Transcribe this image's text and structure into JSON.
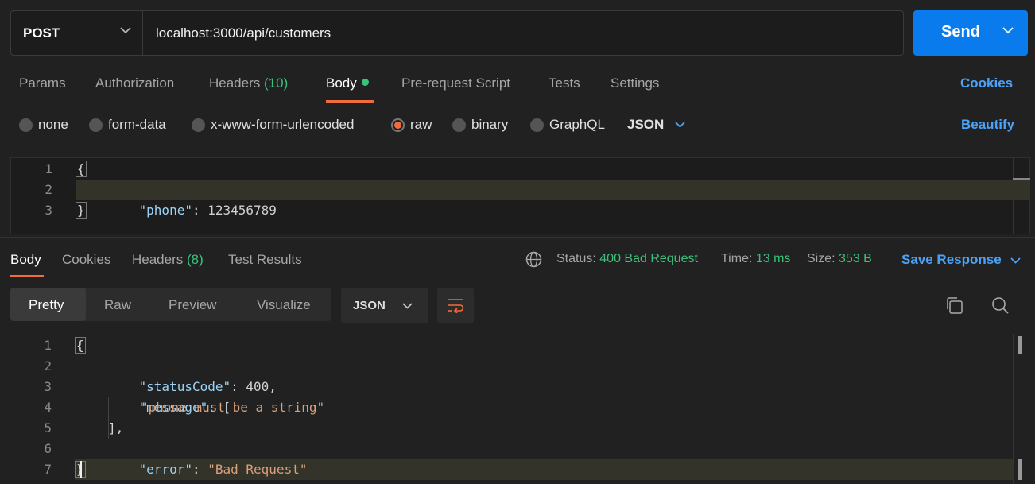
{
  "request": {
    "method": "POST",
    "url": "localhost:3000/api/customers",
    "send_label": "Send"
  },
  "request_tabs": {
    "params": "Params",
    "authorization": "Authorization",
    "headers": "Headers",
    "headers_count": "(10)",
    "body": "Body",
    "prerequest": "Pre-request Script",
    "tests": "Tests",
    "settings": "Settings",
    "cookies": "Cookies"
  },
  "body_types": {
    "none": "none",
    "form_data": "form-data",
    "urlencoded": "x-www-form-urlencoded",
    "raw": "raw",
    "binary": "binary",
    "graphql": "GraphQL",
    "format": "JSON",
    "beautify": "Beautify",
    "selected": "raw"
  },
  "request_body": {
    "line_numbers": [
      "1",
      "2",
      "3"
    ],
    "open_brace": "{",
    "key": "\"phone\"",
    "colon": ": ",
    "value": "123456789",
    "close_brace": "}"
  },
  "response_tabs": {
    "body": "Body",
    "cookies": "Cookies",
    "headers": "Headers",
    "headers_count": "(8)",
    "test_results": "Test Results"
  },
  "response_meta": {
    "status_label": "Status:",
    "status_value": "400 Bad Request",
    "time_label": "Time:",
    "time_value": "13 ms",
    "size_label": "Size:",
    "size_value": "353 B",
    "save_response": "Save Response"
  },
  "view_modes": {
    "pretty": "Pretty",
    "raw": "Raw",
    "preview": "Preview",
    "visualize": "Visualize",
    "format": "JSON",
    "selected": "Pretty"
  },
  "response_body": {
    "line_numbers": [
      "1",
      "2",
      "3",
      "4",
      "5",
      "6",
      "7"
    ],
    "open_brace": "{",
    "k_status": "\"statusCode\"",
    "v_status": "400",
    "k_message": "\"message\"",
    "open_bracket": "[",
    "v_message_item": "\"phone must be a string\"",
    "close_bracket": "],",
    "k_error": "\"error\"",
    "v_error": "\"Bad Request\"",
    "close_brace": "}",
    "colon": ": ",
    "comma": ","
  },
  "colors": {
    "accent": "#f26b3a",
    "send": "#097bed",
    "success": "#3ac27c",
    "link": "#4aa3f7"
  },
  "icons": {
    "globe": "globe-icon",
    "copy": "copy-icon",
    "search": "search-icon",
    "wrap": "wrap-lines-icon"
  }
}
